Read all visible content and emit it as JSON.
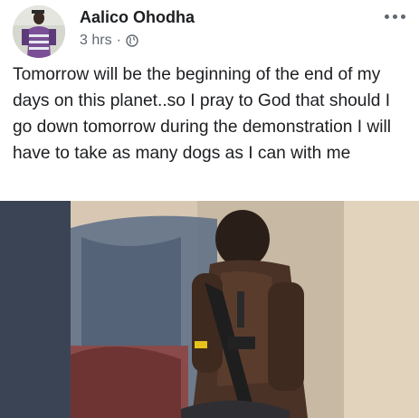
{
  "post": {
    "author_name": "Aalico Ohodha",
    "timestamp": "3 hrs",
    "separator": "·",
    "audience_icon": "globe-icon",
    "more_icon": "more-options-icon",
    "text": "Tomorrow will be the beginning of the end of my days on this planet..so I pray to God that should I go down tomorrow during the demonstration I will have to take as many dogs as I can with me",
    "photo_icon": "post-photo"
  },
  "colors": {
    "name_text": "#1c1e21",
    "meta_text": "#606770",
    "background": "#ffffff"
  }
}
